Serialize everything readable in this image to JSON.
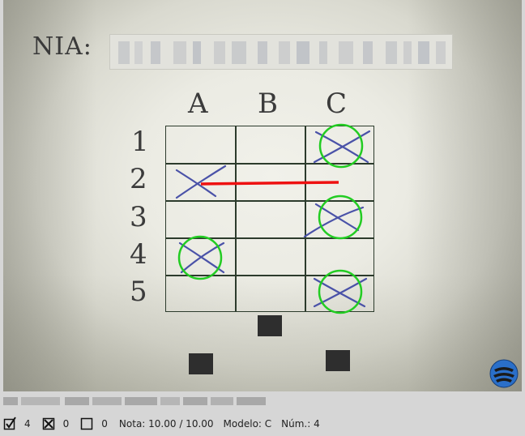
{
  "sheet": {
    "nia_label": "NIA:",
    "columns": [
      "A",
      "B",
      "C"
    ],
    "rows": [
      "1",
      "2",
      "3",
      "4",
      "5"
    ],
    "marked_answers": [
      {
        "row": "1",
        "col": "C",
        "result": "correct"
      },
      {
        "row": "2",
        "col": "A",
        "result": "cancelled"
      },
      {
        "row": "3",
        "col": "C",
        "result": "correct"
      },
      {
        "row": "4",
        "col": "A",
        "result": "correct"
      },
      {
        "row": "5",
        "col": "C",
        "result": "correct"
      }
    ],
    "colors": {
      "pen": "#4a52a8",
      "correct_circle": "#22cc22",
      "cancel_line": "#ee1111",
      "grid": "#2c3b2c"
    }
  },
  "status_bar": {
    "correct_count": "4",
    "wrong_count": "0",
    "blank_count": "0",
    "grade": "Nota: 10.00 / 10.00",
    "model": "Modelo: C",
    "number": "Núm.: 4",
    "icons": {
      "correct": "checked-box-icon",
      "wrong": "crossed-box-icon",
      "blank": "empty-box-icon"
    }
  },
  "logo": {
    "icon": "app-logo-icon",
    "color": "#2a6fc9"
  }
}
